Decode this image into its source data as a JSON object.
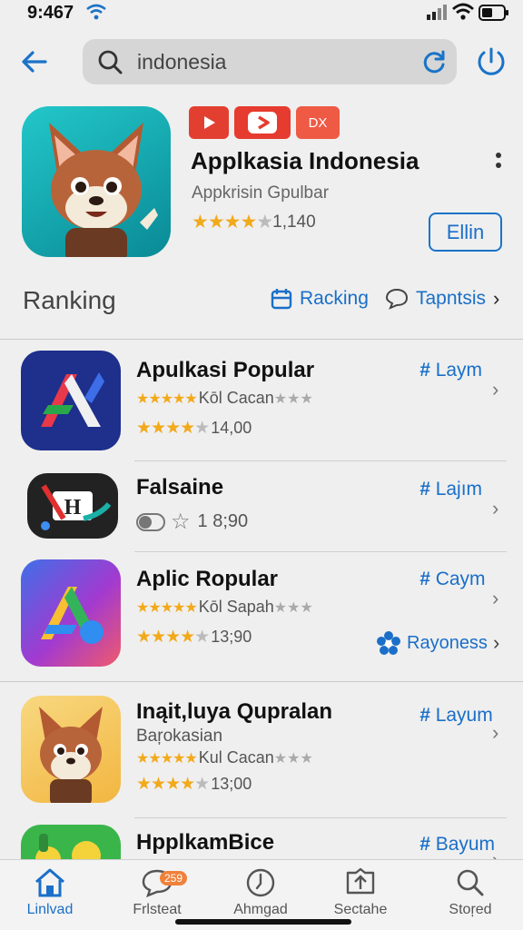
{
  "status_bar": {
    "time": "9:467"
  },
  "search": {
    "value": "indonesia"
  },
  "featured": {
    "badge_text": "DX",
    "title": "Applkasia Indonesia",
    "subtitle": "Appkrisin Gpulbar",
    "rating": 4.5,
    "rating_text": "1,140",
    "get_label": "Ellin"
  },
  "ranking": {
    "title": "Ranking",
    "tab1": "Racking",
    "tab2": "Tapntsis"
  },
  "apps": [
    {
      "name": "Apulkasi Popular",
      "line1": "Kōl Cacan",
      "line2": "14,00",
      "action": "Laym"
    },
    {
      "name": "Falsaine",
      "line1": "1 8;90",
      "action": "Lajım"
    },
    {
      "name": "Aplic Ropular",
      "line1": "Kōl Sapah",
      "line2": "13;90",
      "action": "Caym",
      "extra": "Rayoness"
    },
    {
      "name": "Inąit,luya Qupralan",
      "sub": "Baŗokasian",
      "line1": "Kul Cacan",
      "line2": "13;00",
      "action": "Layum"
    },
    {
      "name": "HpplkamBice",
      "action": "Bayum"
    }
  ],
  "tabbar": {
    "items": [
      {
        "label": "Linlvad",
        "icon": "home-icon"
      },
      {
        "label": "Frlsteat",
        "icon": "chat-icon",
        "badge": "259"
      },
      {
        "label": "Ahmgad",
        "icon": "clock-icon"
      },
      {
        "label": "Sectahe",
        "icon": "apps-icon"
      },
      {
        "label": "Stoŗed",
        "icon": "search-icon"
      }
    ]
  },
  "colors": {
    "accent": "#1a6fc8",
    "star": "#f2a91a",
    "badge_red": "#e23f30"
  }
}
